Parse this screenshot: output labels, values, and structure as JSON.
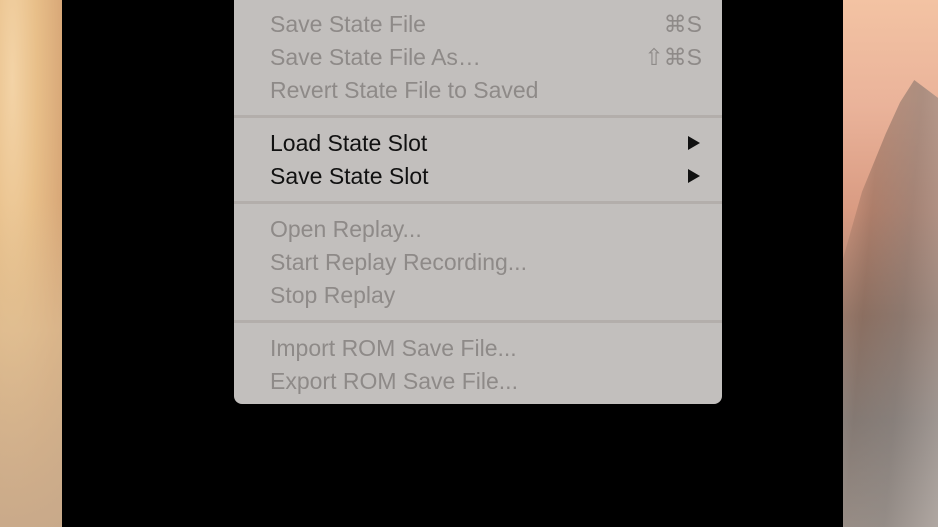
{
  "menu": {
    "partial_item": {
      "label": "Save State File",
      "shortcut": "⌘S"
    },
    "items": [
      {
        "label": "Save State File",
        "shortcut": "⌘S",
        "enabled": false
      },
      {
        "label": "Save State File As…",
        "shortcut": "⇧⌘S",
        "enabled": false
      },
      {
        "label": "Revert State File to Saved",
        "shortcut": "",
        "enabled": false
      },
      {
        "label": "Load State Slot",
        "submenu": true,
        "enabled": true
      },
      {
        "label": "Save State Slot",
        "submenu": true,
        "enabled": true
      },
      {
        "label": "Open Replay...",
        "enabled": false
      },
      {
        "label": "Start Replay Recording...",
        "enabled": false
      },
      {
        "label": "Stop Replay",
        "enabled": false
      },
      {
        "label": "Import ROM Save File...",
        "enabled": false
      },
      {
        "label": "Export ROM Save File...",
        "enabled": false
      }
    ]
  },
  "colors": {
    "menu_bg": "#c8c5c3",
    "disabled_text": "#8e8a88",
    "enabled_text": "#111111",
    "separator": "#b3aeab"
  }
}
